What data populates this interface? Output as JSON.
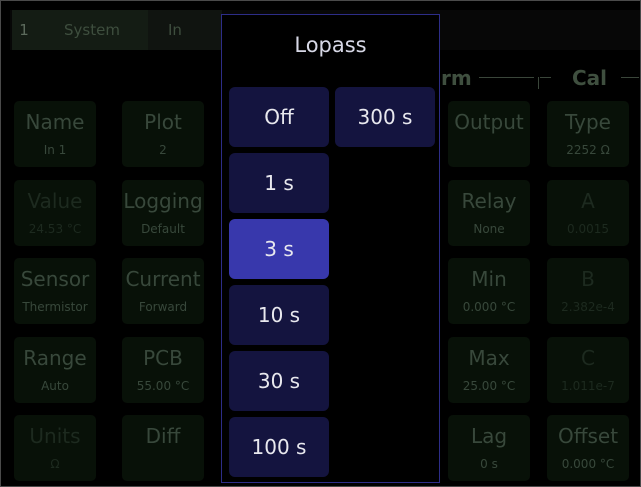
{
  "tabs": {
    "channel_number": "1",
    "system": "System",
    "input": "In"
  },
  "sections": {
    "alarm": "rm",
    "cal": "Cal"
  },
  "cells": {
    "name": {
      "title": "Name",
      "value": "In 1"
    },
    "plot": {
      "title": "Plot",
      "value": "2"
    },
    "value": {
      "title": "Value",
      "value": "24.53 °C"
    },
    "logging": {
      "title": "Logging",
      "value": "Default"
    },
    "sensor": {
      "title": "Sensor",
      "value": "Thermistor"
    },
    "current": {
      "title": "Current",
      "value": "Forward"
    },
    "range": {
      "title": "Range",
      "value": "Auto"
    },
    "pcb": {
      "title": "PCB",
      "value": "55.00 °C"
    },
    "units": {
      "title": "Units",
      "value": "Ω"
    },
    "diff": {
      "title": "Diff",
      "value": ""
    },
    "output": {
      "title": "Output",
      "value": ""
    },
    "relay": {
      "title": "Relay",
      "value": "None"
    },
    "min": {
      "title": "Min",
      "value": "0.000 °C"
    },
    "max": {
      "title": "Max",
      "value": "25.00 °C"
    },
    "lag": {
      "title": "Lag",
      "value": "0 s"
    },
    "type": {
      "title": "Type",
      "value": "2252 Ω"
    },
    "a": {
      "title": "A",
      "value": "0.0015"
    },
    "b": {
      "title": "B",
      "value": "2.382e-4"
    },
    "c": {
      "title": "C",
      "value": "1.011e-7"
    },
    "offset": {
      "title": "Offset",
      "value": "0.000 °C"
    }
  },
  "popup": {
    "title": "Lopass",
    "options": [
      "Off",
      "1 s",
      "3 s",
      "10 s",
      "30 s",
      "100 s",
      "300 s"
    ],
    "selected": "3 s"
  },
  "colors": {
    "popup_border": "#2d2d88",
    "option_bg": "#14143f",
    "option_selected_bg": "#3838ac"
  }
}
